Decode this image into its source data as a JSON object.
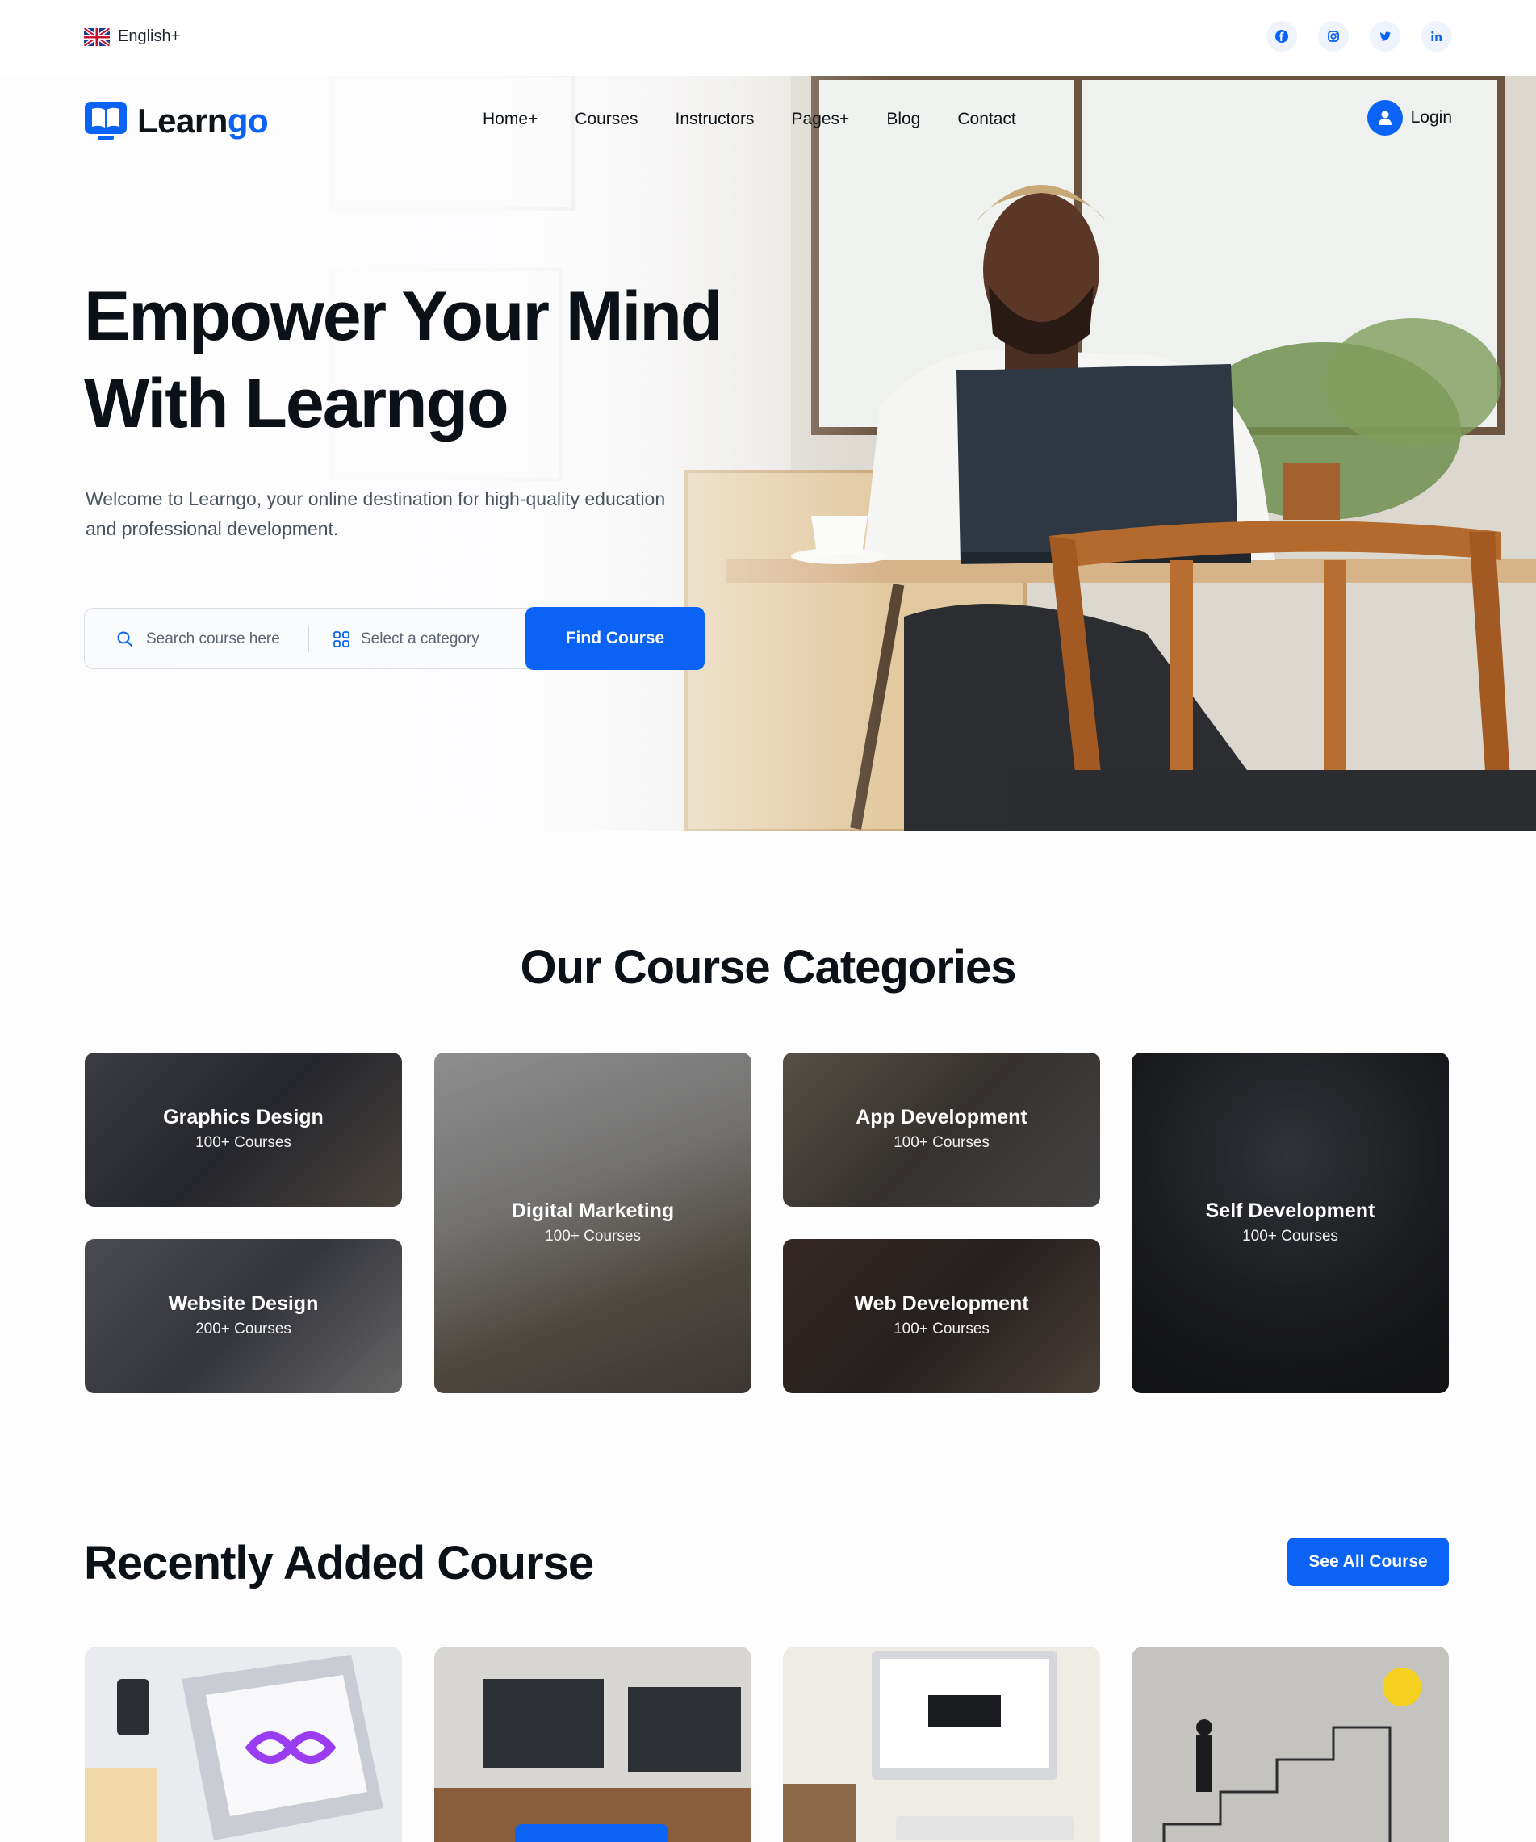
{
  "topbar": {
    "language": "English+",
    "socials": [
      {
        "icon": "facebook-icon"
      },
      {
        "icon": "instagram-icon"
      },
      {
        "icon": "twitter-icon"
      },
      {
        "icon": "linkedin-icon"
      }
    ]
  },
  "brand": {
    "name_part1": "Learn",
    "name_part2": "go",
    "accent": "#0a63f5"
  },
  "nav": {
    "items": [
      "Home+",
      "Courses",
      "Instructors",
      "Pages+",
      "Blog",
      "Contact"
    ],
    "login": "Login"
  },
  "hero": {
    "title_line1": "Empower Your Mind",
    "title_line2": "With Learngo",
    "subtitle": "Welcome to Learngo, your online destination for high-quality education and professional development.",
    "search_placeholder": "Search course here",
    "category_placeholder": "Select a category",
    "button": "Find Course"
  },
  "categories": {
    "title": "Our Course Categories",
    "items": [
      {
        "name": "Graphics Design",
        "count": "100+ Courses"
      },
      {
        "name": "Website Design",
        "count": "200+ Courses"
      },
      {
        "name": "Digital Marketing",
        "count": "100+ Courses"
      },
      {
        "name": "App Development",
        "count": "100+ Courses"
      },
      {
        "name": "Web Development",
        "count": "100+ Courses"
      },
      {
        "name": "Self Development",
        "count": "100+ Courses"
      }
    ]
  },
  "recent": {
    "title": "Recently Added Course",
    "button": "See All Course"
  }
}
